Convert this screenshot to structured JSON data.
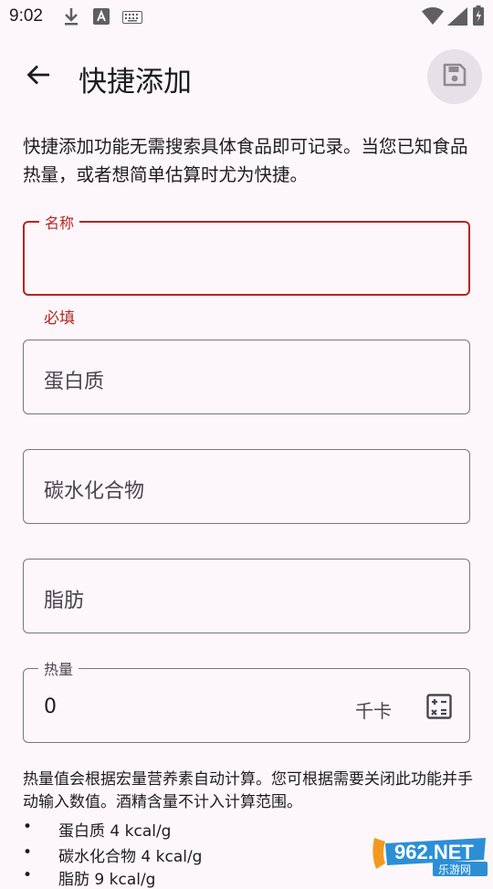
{
  "status_bar": {
    "time": "9:02",
    "icons": [
      "download-icon",
      "a-square-icon",
      "keyboard-icon",
      "wifi-icon",
      "battery-icon"
    ]
  },
  "app_bar": {
    "title": "快捷添加",
    "back_icon": "arrow-left-icon",
    "save_icon": "save-icon"
  },
  "intro_text": "快捷添加功能无需搜索具体食品即可记录。当您已知食品热量，或者想简单估算时尤为快捷。",
  "fields": {
    "name": {
      "label": "名称",
      "value": "",
      "error": "必填"
    },
    "protein": {
      "placeholder": "蛋白质"
    },
    "carbs": {
      "placeholder": "碳水化合物"
    },
    "fat": {
      "placeholder": "脂肪"
    },
    "calories": {
      "label": "热量",
      "value": "0",
      "suffix": "千卡",
      "icon": "calculator-icon"
    }
  },
  "note": {
    "text": "热量值会根据宏量营养素自动计算。您可根据需要关闭此功能并手动输入数值。酒精含量不计入计算范围。",
    "bullets": [
      {
        "dot": "•",
        "text": "蛋白质 4 kcal/g"
      },
      {
        "dot": "•",
        "text": "碳水化合物 4 kcal/g"
      },
      {
        "dot": "•",
        "text": "脂肪 9 kcal/g"
      }
    ]
  },
  "watermark": {
    "text": "962.NET",
    "subtext": "乐游网"
  },
  "colors": {
    "background": "#FDF7FB",
    "error": "#B3261E",
    "outline": "#79747E",
    "fab": "#E6E1E8"
  }
}
